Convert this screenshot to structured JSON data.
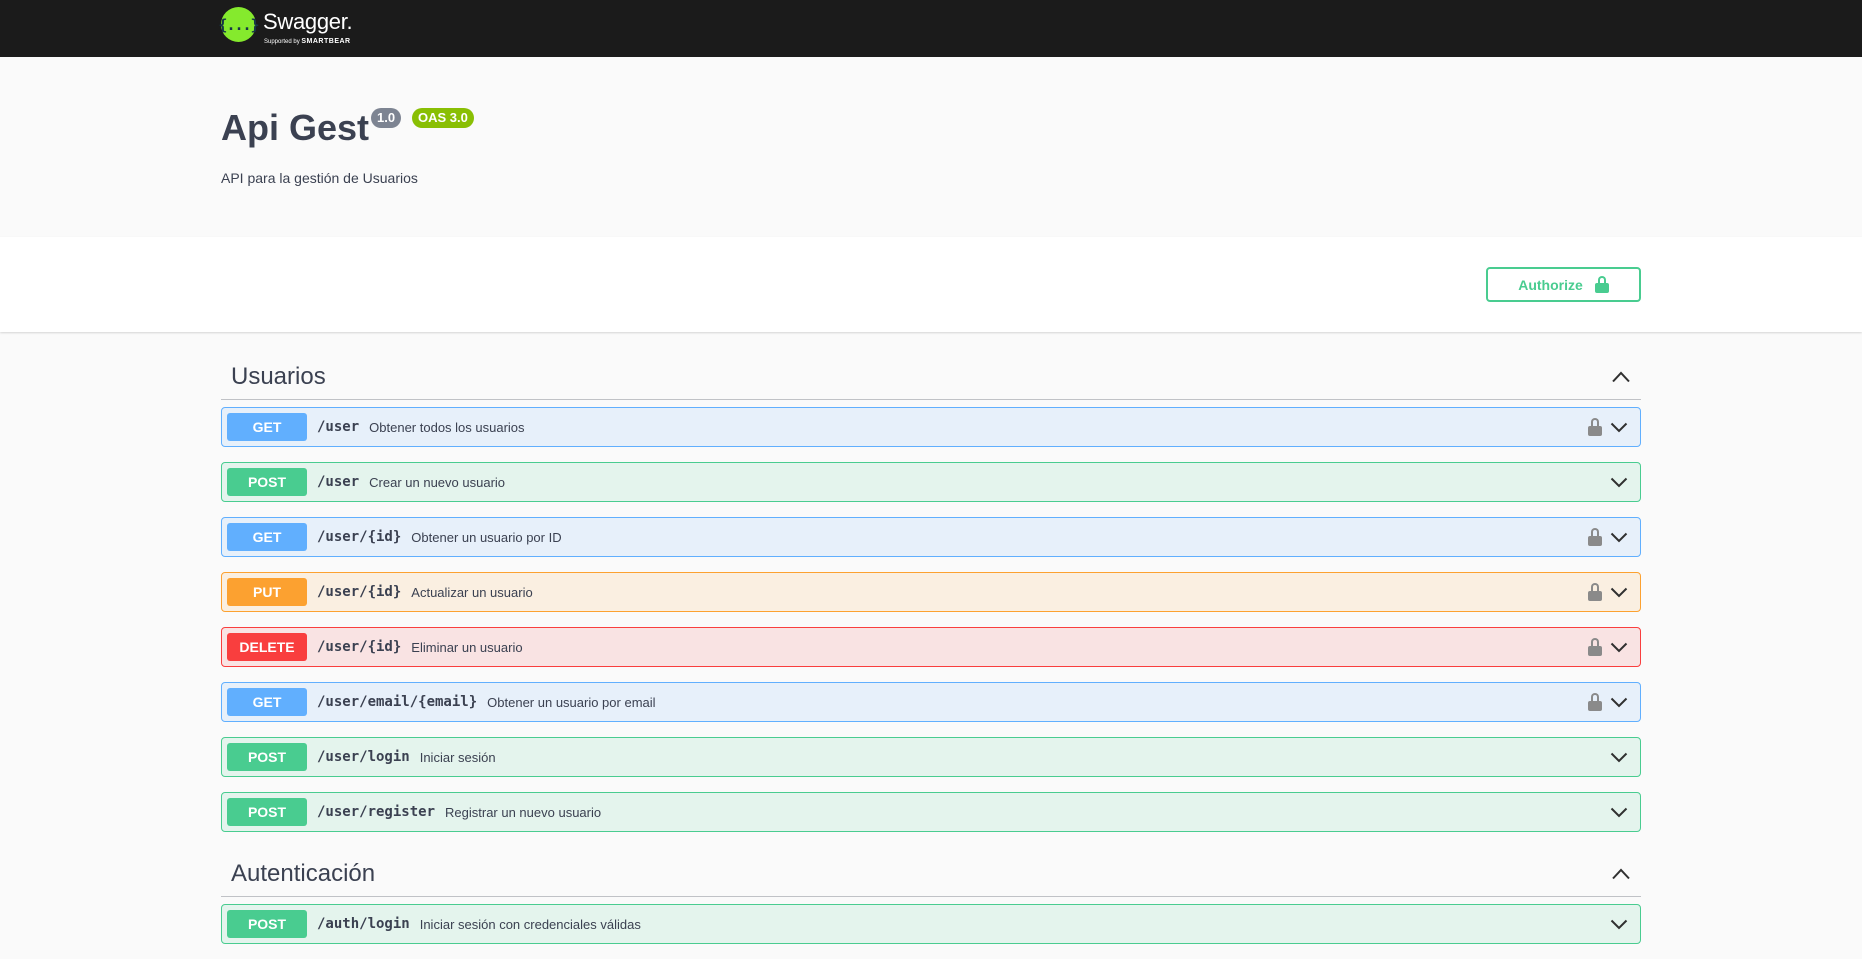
{
  "topbar": {
    "logo_mark": "{...}",
    "logo_name": "Swagger.",
    "logo_sub_prefix": "Supported by",
    "logo_sub_brand": "SMARTBEAR"
  },
  "info": {
    "title": "Api Gest",
    "version": "1.0",
    "oas": "OAS 3.0",
    "description": "API para la gestión de Usuarios"
  },
  "authorize_label": "Authorize",
  "tags": [
    {
      "name": "Usuarios",
      "operations": [
        {
          "method": "GET",
          "path": "/user",
          "summary": "Obtener todos los usuarios"
        },
        {
          "method": "POST",
          "path": "/user",
          "summary": "Crear un nuevo usuario"
        },
        {
          "method": "GET",
          "path": "/user/{id}",
          "summary": "Obtener un usuario por ID"
        },
        {
          "method": "PUT",
          "path": "/user/{id}",
          "summary": "Actualizar un usuario"
        },
        {
          "method": "DELETE",
          "path": "/user/{id}",
          "summary": "Eliminar un usuario"
        },
        {
          "method": "GET",
          "path": "/user/email/{email}",
          "summary": "Obtener un usuario por email"
        },
        {
          "method": "POST",
          "path": "/user/login",
          "summary": "Iniciar sesión"
        },
        {
          "method": "POST",
          "path": "/user/register",
          "summary": "Registrar un nuevo usuario"
        }
      ]
    },
    {
      "name": "Autenticación",
      "operations": [
        {
          "method": "POST",
          "path": "/auth/login",
          "summary": "Iniciar sesión con credenciales válidas"
        }
      ]
    }
  ],
  "colors": {
    "get": "#61affe",
    "post": "#49cc90",
    "put": "#fca130",
    "delete": "#f93e3e",
    "topbar": "#1b1b1b",
    "logo_green": "#85ea2d"
  },
  "icons": {
    "operation_lock": "padlock-icon",
    "operation_expand": "chevron-down-icon",
    "tag_collapse": "chevron-up-icon",
    "authorize": "unlocked-padlock-icon"
  }
}
